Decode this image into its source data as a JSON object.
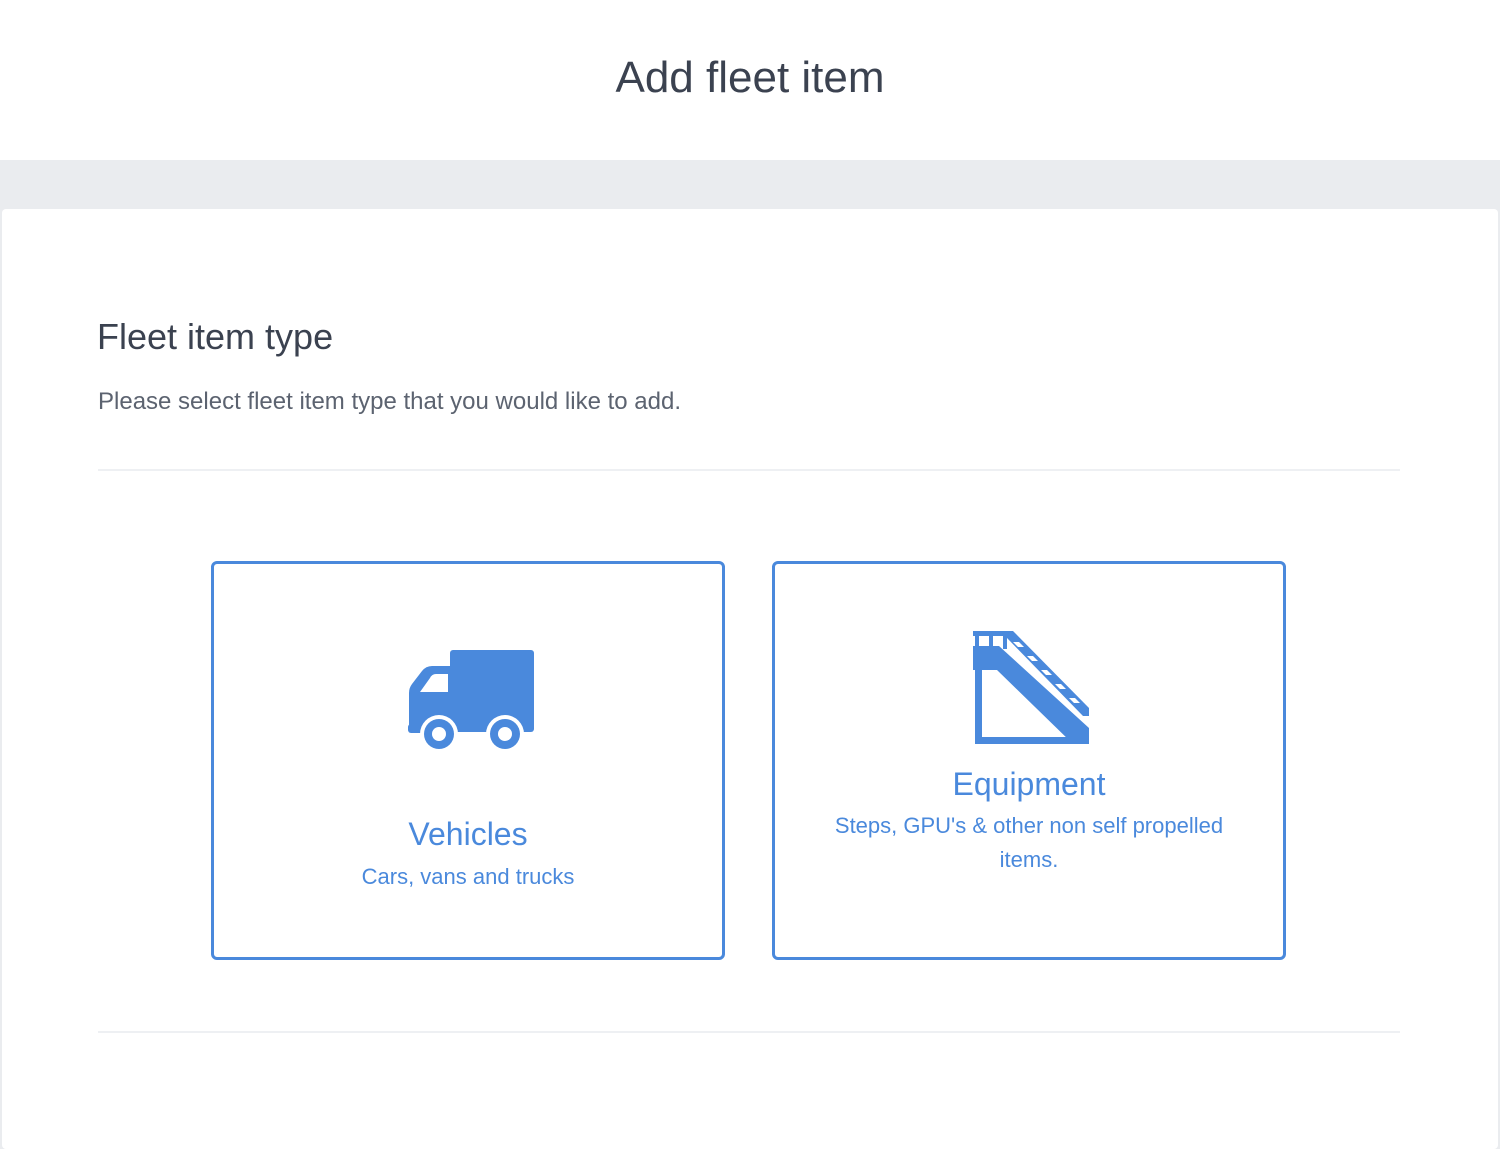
{
  "header": {
    "title": "Add fleet item"
  },
  "section": {
    "title": "Fleet item type",
    "description": "Please select fleet item type that you would like to add."
  },
  "options": [
    {
      "title": "Vehicles",
      "subtitle": "Cars, vans and trucks",
      "icon": "truck-icon"
    },
    {
      "title": "Equipment",
      "subtitle": "Steps, GPU's & other non self propelled items.",
      "icon": "stairs-icon"
    }
  ],
  "colors": {
    "accent": "#4a89dc",
    "text": "#3b4250",
    "muted": "#5c6370",
    "background": "#eaecef"
  }
}
